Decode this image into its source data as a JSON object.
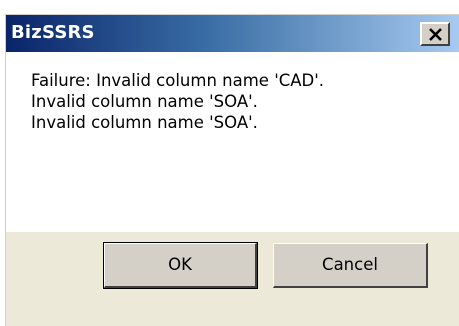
{
  "window": {
    "title": "BizSSRS"
  },
  "message": {
    "lines": [
      "Failure: Invalid column name 'CAD'.",
      "Invalid column name 'SOA'.",
      "Invalid column name 'SOA'."
    ]
  },
  "buttons": {
    "ok_label": "OK",
    "cancel_label": "Cancel"
  },
  "icons": {
    "close": "close-icon"
  },
  "colors": {
    "titlebar_start": "#0a246a",
    "titlebar_end": "#a6caf0",
    "dialog_face": "#ece9d8",
    "button_face": "#d4d0c8"
  }
}
